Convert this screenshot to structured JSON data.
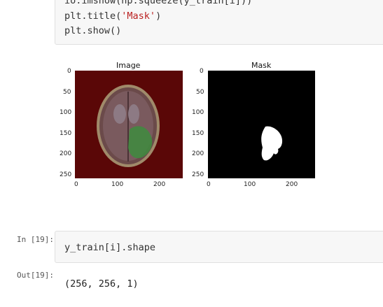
{
  "cell18": {
    "code": {
      "line0": "io.imshow(np.squeeze(y_train[i]))",
      "line1_pre": "plt.title(",
      "line1_str": "'Mask'",
      "line1_post": ")",
      "line2": "plt.show()"
    },
    "figure": {
      "left_title": "Image",
      "right_title": "Mask",
      "y_ticks": [
        "0",
        "50",
        "100",
        "150",
        "200",
        "250"
      ],
      "x_ticks": [
        "0",
        "100",
        "200"
      ]
    }
  },
  "cell19": {
    "in_prompt": "In [19]:",
    "code": "y_train[i].shape",
    "out_prompt": "Out[19]:",
    "output": "(256, 256, 1)"
  },
  "colors": {
    "cell_bg": "#f7f7f7",
    "string": "#ba2121",
    "brain_bg": "#5a0707",
    "tumor": "#3e8c3e",
    "mask_bg": "#000000",
    "mask_fg": "#ffffff"
  }
}
